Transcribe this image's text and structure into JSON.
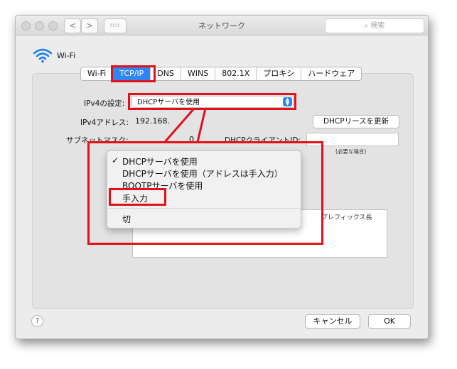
{
  "window": {
    "title": "ネットワーク",
    "search_placeholder": "検索",
    "grid_icon": "•••• ",
    "nav_back": "<",
    "nav_forward": ">"
  },
  "service": {
    "icon": "wifi-icon",
    "name": "Wi-Fi"
  },
  "tabs": [
    {
      "label": "Wi-Fi",
      "active": false
    },
    {
      "label": "TCP/IP",
      "active": true
    },
    {
      "label": "DNS",
      "active": false
    },
    {
      "label": "WINS",
      "active": false
    },
    {
      "label": "802.1X",
      "active": false
    },
    {
      "label": "プロキシ",
      "active": false
    },
    {
      "label": "ハードウェア",
      "active": false
    }
  ],
  "form": {
    "ipv4_config_label": "IPv4の設定:",
    "ipv4_config_value": "DHCPサーバを使用",
    "ipv4_address_label": "IPv4アドレス:",
    "ipv4_address_value": "192.168.",
    "subnet_mask_label": "サブネットマスク:",
    "subnet_mask_value_fragment": "0",
    "dhcp_client_id_label": "DHCPクライアントID:",
    "dhcp_client_id_value": "",
    "dhcp_client_id_note": "(必要な場合)",
    "renew_button": "DHCPリースを更新",
    "prefix_length_header": "プレフィックス長"
  },
  "dropdown_menu": {
    "items": [
      {
        "label": "DHCPサーバを使用",
        "checked": true
      },
      {
        "label": "DHCPサーバを使用（アドレスは手入力）",
        "checked": false
      },
      {
        "label": "BOOTPサーバを使用",
        "checked": false
      },
      {
        "label": "手入力",
        "checked": false,
        "highlighted": true
      },
      {
        "label": "切",
        "checked": false
      }
    ],
    "check_mark": "✓"
  },
  "footer": {
    "help": "?",
    "cancel_button": "キャンセル",
    "ok_button": "OK"
  },
  "colors": {
    "accent": "#2f86f3",
    "annotation_red": "#e3101b"
  }
}
